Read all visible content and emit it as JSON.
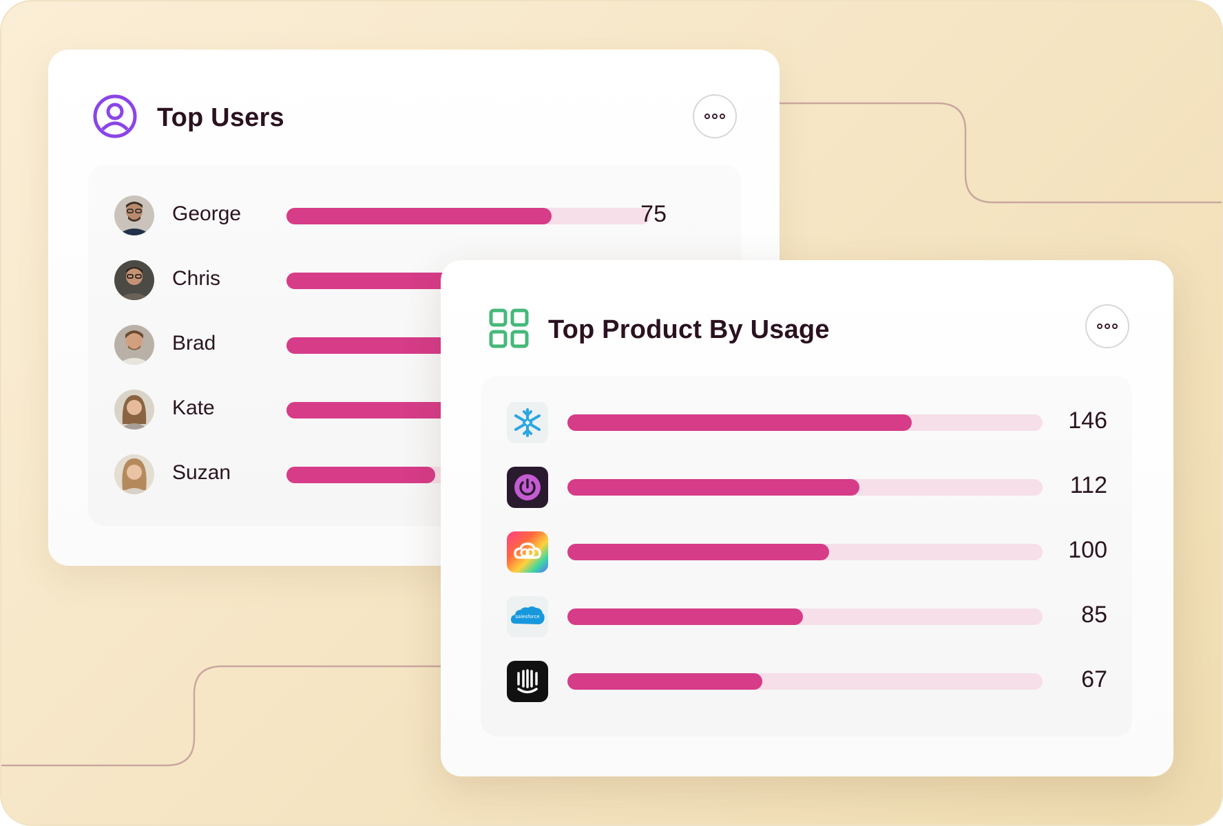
{
  "colors": {
    "bar_fill": "#d63c88",
    "bar_track": "#f6dfe8",
    "title_text": "#2b1220",
    "users_icon": "#8a45e6",
    "products_icon": "#46b87a"
  },
  "top_users": {
    "title": "Top Users",
    "icon": "user-circle-icon",
    "menu_icon": "more-dots-icon",
    "rows": [
      {
        "name": "George",
        "value": "75",
        "fraction": 0.73
      },
      {
        "name": "Chris",
        "value": "",
        "fraction": 0.45
      },
      {
        "name": "Brad",
        "value": "",
        "fraction": 0.45
      },
      {
        "name": "Kate",
        "value": "",
        "fraction": 0.45
      },
      {
        "name": "Suzan",
        "value": "",
        "fraction": 0.41
      }
    ]
  },
  "top_products": {
    "title": "Top Product By Usage",
    "icon": "grid-icon",
    "menu_icon": "more-dots-icon",
    "rows": [
      {
        "product_icon": "snowflake-icon",
        "value": "146",
        "fraction": 0.725
      },
      {
        "product_icon": "power-icon",
        "value": "112",
        "fraction": 0.615
      },
      {
        "product_icon": "creative-cloud-icon",
        "value": "100",
        "fraction": 0.55
      },
      {
        "product_icon": "salesforce-icon",
        "logo_text": "salesforce",
        "value": "85",
        "fraction": 0.495
      },
      {
        "product_icon": "intercom-icon",
        "value": "67",
        "fraction": 0.41
      }
    ]
  }
}
